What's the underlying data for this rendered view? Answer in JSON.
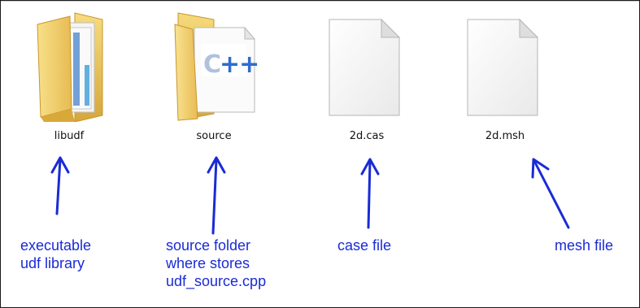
{
  "files": [
    {
      "name": "libudf",
      "icon": "folder-icon"
    },
    {
      "name": "source",
      "icon": "folder-cpp-icon",
      "badge": "++"
    },
    {
      "name": "2d.cas",
      "icon": "blank-file-icon"
    },
    {
      "name": "2d.msh",
      "icon": "blank-file-icon"
    }
  ],
  "annotations": [
    {
      "lines": [
        "executable",
        "udf library"
      ]
    },
    {
      "lines": [
        "source folder",
        "where stores",
        "udf_source.cpp"
      ]
    },
    {
      "lines": [
        "case file"
      ]
    },
    {
      "lines": [
        "mesh file"
      ]
    }
  ],
  "colors": {
    "annotation": "#1a2bd6",
    "folder": "#f2cf66",
    "folder_dark": "#d9a933"
  }
}
